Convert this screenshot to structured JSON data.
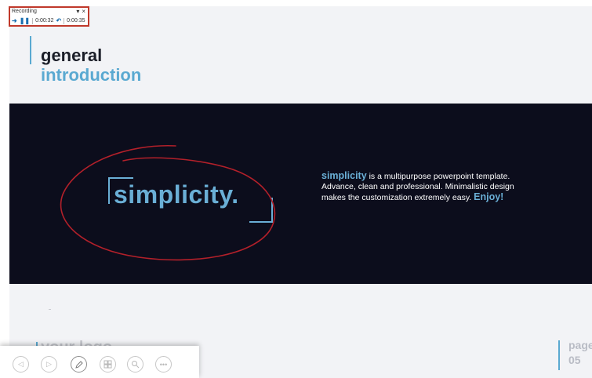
{
  "recording": {
    "title": "Recording",
    "menu_icon": "▾",
    "close_icon": "×",
    "elapsed": "0:00:32",
    "total": "0:00:35"
  },
  "slide": {
    "title_line1": "general",
    "title_line2": "introduction",
    "logo_text": "simplicity.",
    "description": {
      "highlight": "simplicity",
      "body": " is a multipurpose powerpoint template. Advance, clean and professional. Minimalistic design makes the customization extremely easy. ",
      "closing": "Enjoy!"
    },
    "footer_logo": "your logo",
    "page_label": "page",
    "page_number": "05"
  },
  "colors": {
    "accent": "#5aa9d1",
    "band": "#0c0d1c",
    "annotation": "#b3202a",
    "recording_border": "#c0392b"
  },
  "toolbar": {
    "buttons": [
      {
        "name": "previous-slide",
        "icon": "chevron-left-icon"
      },
      {
        "name": "next-slide",
        "icon": "chevron-right-icon"
      },
      {
        "name": "pen",
        "icon": "pen-icon"
      },
      {
        "name": "slides-grid",
        "icon": "grid-icon"
      },
      {
        "name": "zoom",
        "icon": "zoom-icon"
      },
      {
        "name": "more-options",
        "icon": "more-icon"
      }
    ]
  }
}
